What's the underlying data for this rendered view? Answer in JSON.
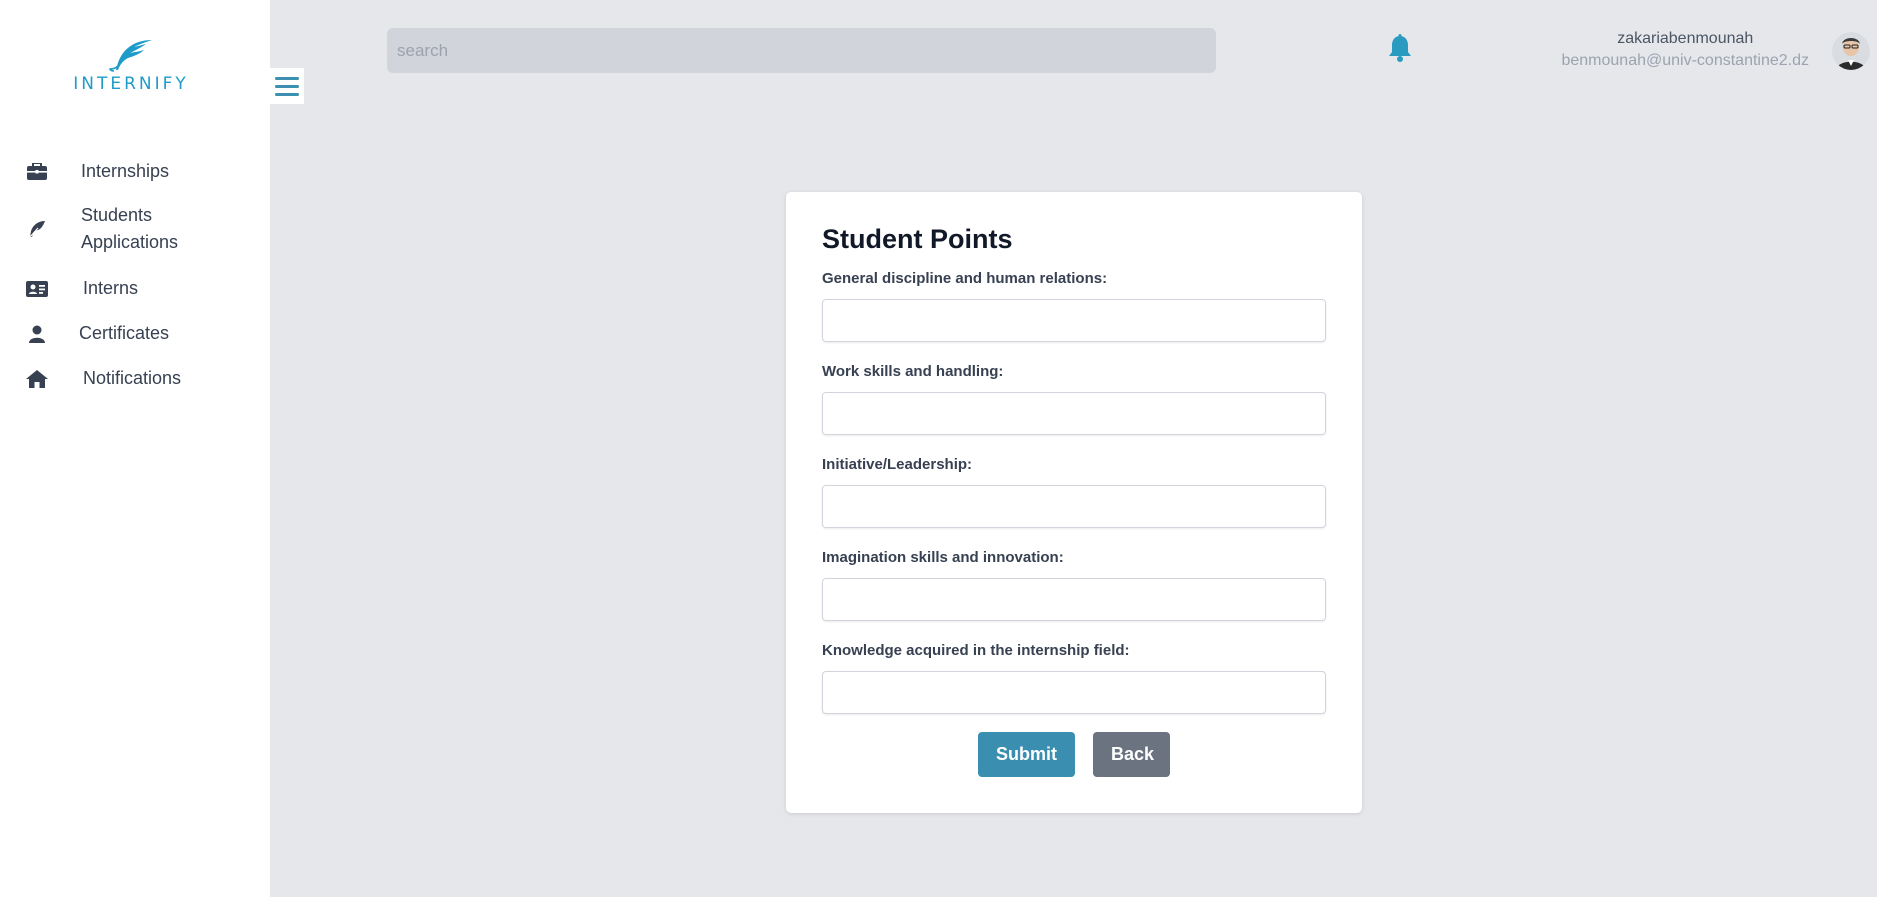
{
  "brand": {
    "name": "INTERNIFY",
    "color": "#1e9bc8",
    "icon": "feather-logo"
  },
  "sidebar": {
    "items": [
      {
        "label": "Internships",
        "icon": "briefcase-icon"
      },
      {
        "label": "Students Applications",
        "icon": "feather-icon"
      },
      {
        "label": "Interns",
        "icon": "id-card-icon"
      },
      {
        "label": "Certificates",
        "icon": "user-icon"
      },
      {
        "label": "Notifications",
        "icon": "home-icon"
      }
    ]
  },
  "header": {
    "search_placeholder": "search",
    "user_name": "zakariabenmounah",
    "user_email": "benmounah@univ-constantine2.dz"
  },
  "form": {
    "title": "Student Points",
    "fields": [
      {
        "label": "General discipline and human relations:",
        "value": ""
      },
      {
        "label": "Work skills and handling:",
        "value": ""
      },
      {
        "label": "Initiative/Leadership:",
        "value": ""
      },
      {
        "label": "Imagination skills and innovation:",
        "value": ""
      },
      {
        "label": "Knowledge acquired in the internship field:",
        "value": ""
      }
    ],
    "submit_label": "Submit",
    "back_label": "Back"
  },
  "colors": {
    "accent": "#3a8fb0",
    "bell": "#2a9bc0",
    "back_button": "#6b7280",
    "background": "#e5e7eb"
  }
}
